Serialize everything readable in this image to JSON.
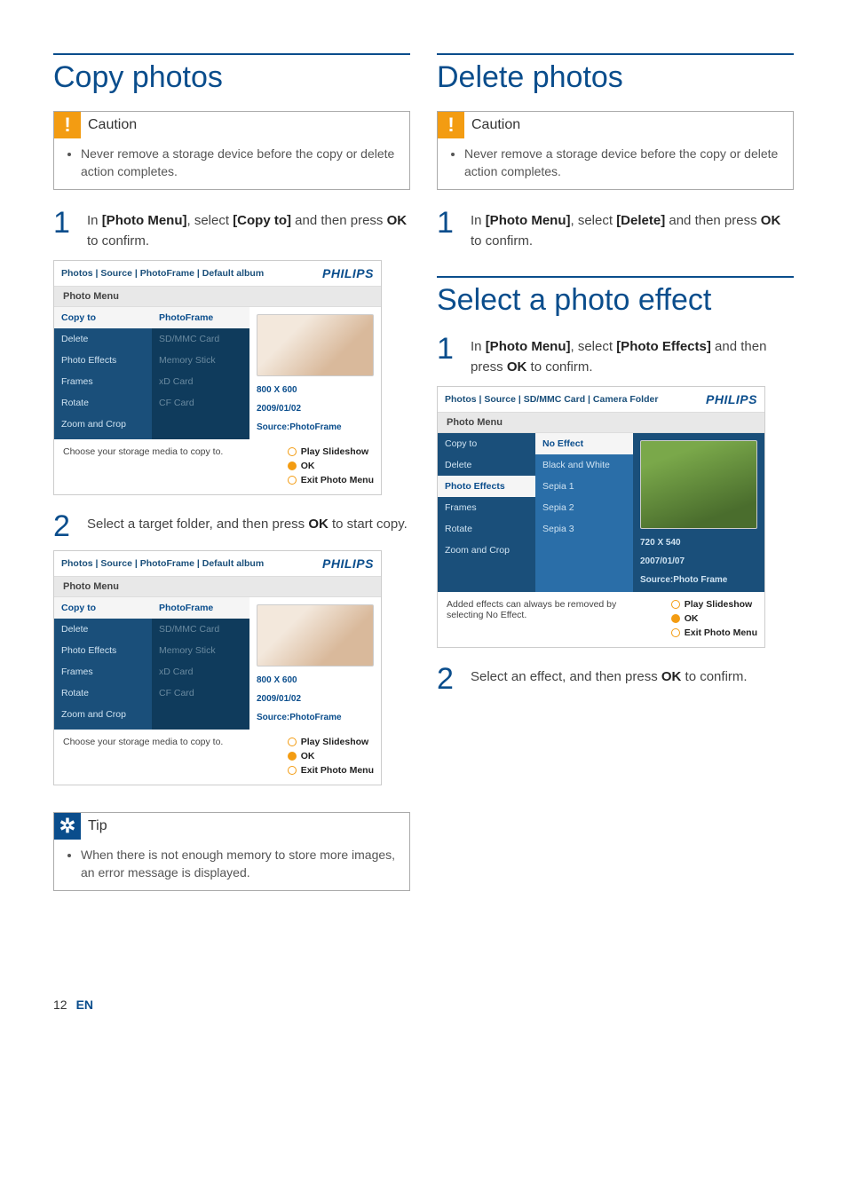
{
  "page": {
    "number": "12",
    "lang": "EN"
  },
  "left": {
    "heading": "Copy photos",
    "caution": {
      "title": "Caution",
      "text": "Never remove a storage device before the copy or delete action completes."
    },
    "step1": {
      "num": "1",
      "pre": "In ",
      "b1": "[Photo Menu]",
      "mid": ", select ",
      "b2": "[Copy to]",
      "post": " and then press ",
      "b3": "OK",
      "tail": " to confirm."
    },
    "step2": {
      "num": "2",
      "pre": "Select a target folder, and then press ",
      "b1": "OK",
      "post": " to start copy."
    },
    "tip": {
      "title": "Tip",
      "text": "When there is not enough memory to store more images, an error message is displayed."
    }
  },
  "right": {
    "heading1": "Delete photos",
    "caution": {
      "title": "Caution",
      "text": "Never remove a storage device before the copy or delete action completes."
    },
    "step_del": {
      "num": "1",
      "pre": "In ",
      "b1": "[Photo Menu]",
      "mid": ", select ",
      "b2": "[Delete]",
      "post": " and then press ",
      "b3": "OK",
      "tail": " to confirm."
    },
    "heading2": "Select a photo effect",
    "step_eff1": {
      "num": "1",
      "pre": "In ",
      "b1": "[Photo Menu]",
      "mid": ", select ",
      "b2": "[Photo Effects]",
      "post": " and then press ",
      "b3": "OK",
      "tail": " to confirm."
    },
    "step_eff2": {
      "num": "2",
      "pre": "Select an effect, and then press ",
      "b1": "OK",
      "post": " to confirm."
    }
  },
  "ui_copy": {
    "breadcrumb": "Photos | Source | PhotoFrame | Default album",
    "brand": "PHILIPS",
    "title": "Photo Menu",
    "menu": [
      "Copy to",
      "Delete",
      "Photo Effects",
      "Frames",
      "Rotate",
      "Zoom and Crop"
    ],
    "submenu_head": "PhotoFrame",
    "submenu": [
      "SD/MMC Card",
      "Memory Stick",
      "xD Card",
      "CF Card"
    ],
    "meta": [
      "800 X 600",
      "2009/01/02",
      "Source:PhotoFrame"
    ],
    "help": "Choose your storage media to copy to.",
    "btns": [
      "Play Slideshow",
      "OK",
      "Exit Photo Menu"
    ]
  },
  "ui_effect": {
    "breadcrumb": "Photos | Source | SD/MMC Card | Camera Folder",
    "brand": "PHILIPS",
    "title": "Photo Menu",
    "menu": [
      "Copy to",
      "Delete",
      "Photo Effects",
      "Frames",
      "Rotate",
      "Zoom and Crop"
    ],
    "submenu": [
      "No Effect",
      "Black and White",
      "Sepia 1",
      "Sepia 2",
      "Sepia 3"
    ],
    "meta": [
      "720 X 540",
      "2007/01/07",
      "Source:Photo Frame"
    ],
    "help": "Added effects can always be removed by selecting No Effect.",
    "btns": [
      "Play Slideshow",
      "OK",
      "Exit Photo Menu"
    ]
  }
}
